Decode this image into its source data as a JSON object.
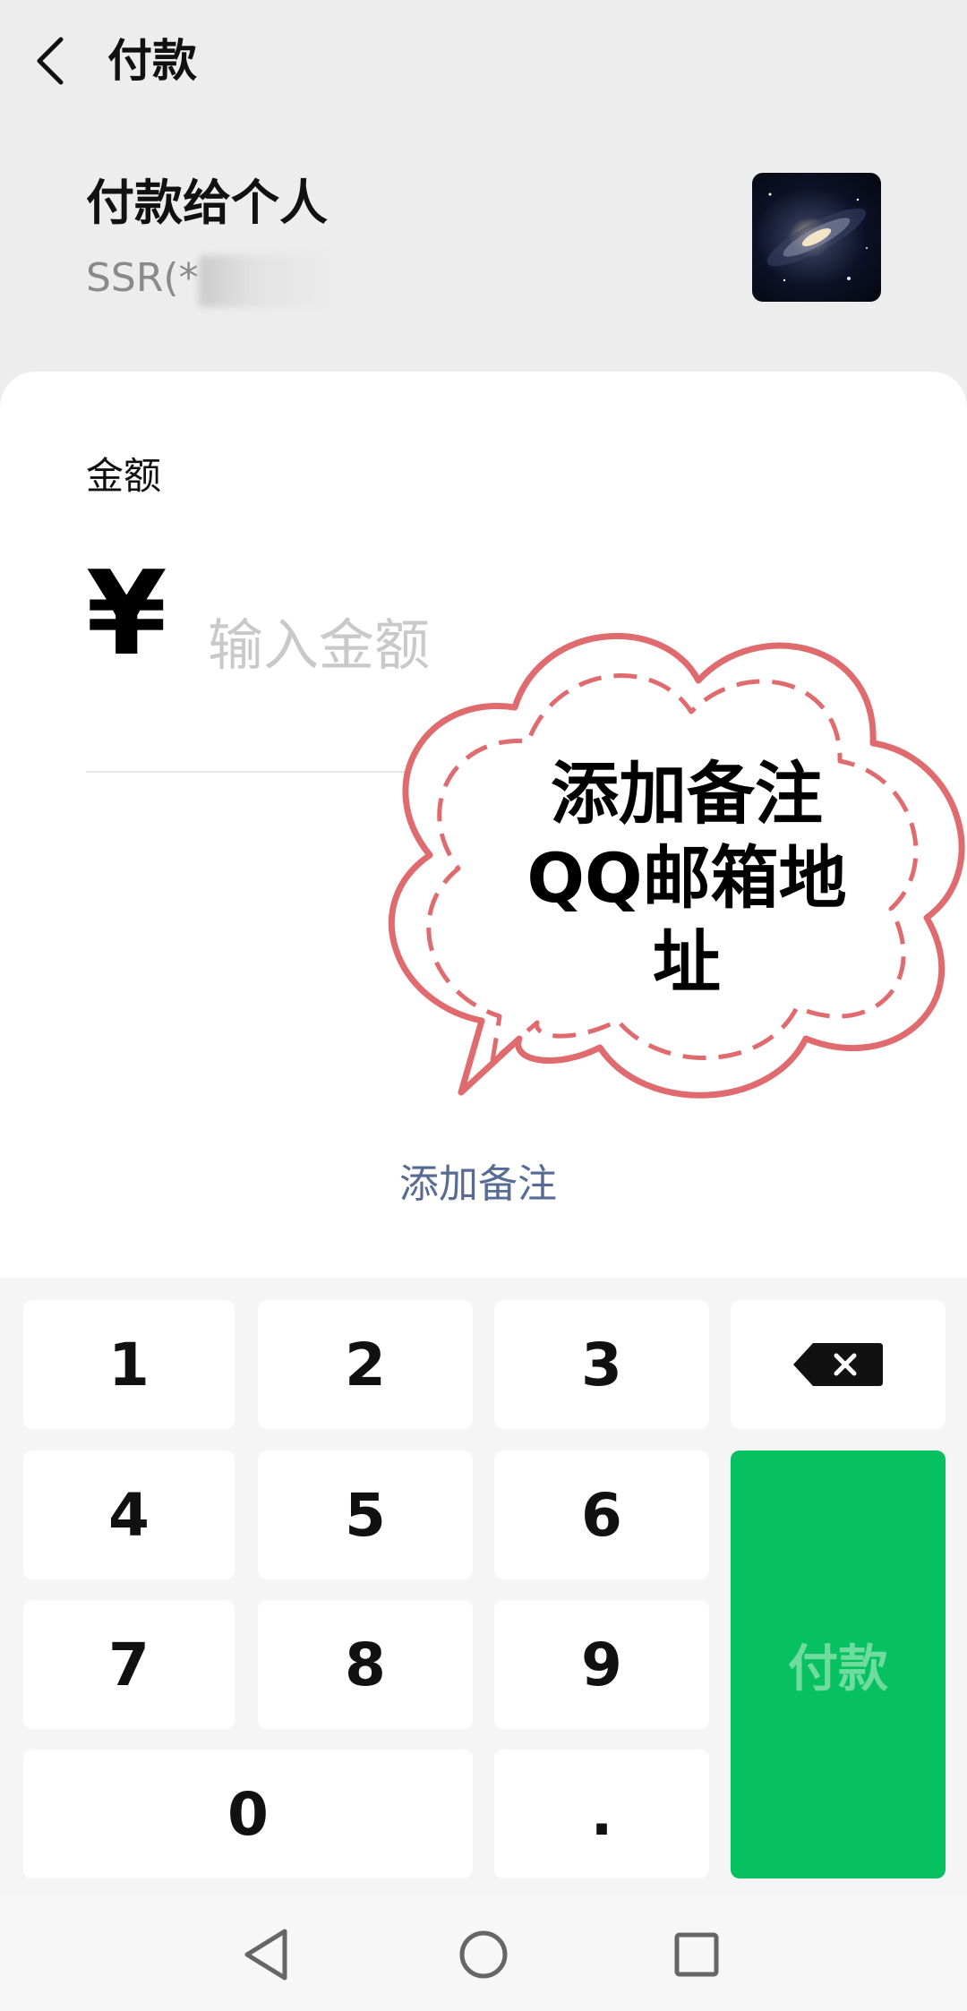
{
  "nav": {
    "title": "付款"
  },
  "payee": {
    "heading": "付款给个人",
    "account": "SSR(*"
  },
  "amount": {
    "label": "金额",
    "currency_symbol": "¥",
    "placeholder": "输入金额"
  },
  "note": {
    "link_label": "添加备注"
  },
  "overlay": {
    "lines": [
      "添加备注",
      "QQ邮箱地",
      "址"
    ],
    "stroke_color": "#e06b6f"
  },
  "keypad": {
    "keys": [
      "1",
      "2",
      "3",
      "4",
      "5",
      "6",
      "7",
      "8",
      "9",
      "0",
      "."
    ],
    "pay_label": "付款",
    "pay_color": "#07c160"
  },
  "icons": {
    "back": "chevron-left-icon",
    "backspace": "backspace-icon",
    "sys_back": "triangle-back-icon",
    "sys_home": "circle-home-icon",
    "sys_recent": "square-recent-icon"
  }
}
